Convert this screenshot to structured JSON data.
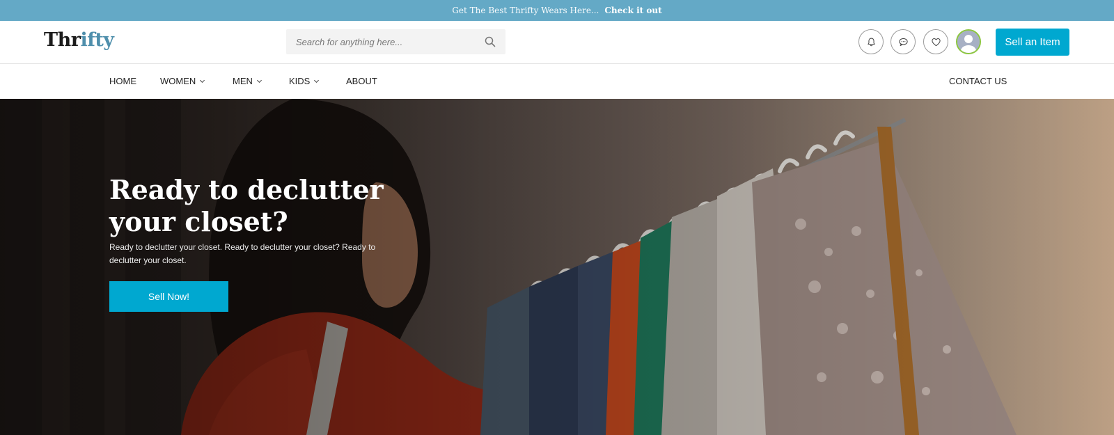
{
  "announcement": {
    "lead": "Get The Best Thrifty Wears Here...",
    "cta": "Check it out"
  },
  "header": {
    "logo_part1": "Thr",
    "logo_part2": "ifty",
    "search_placeholder": "Search for anything here...",
    "sell_label": "Sell an Item",
    "icons": [
      "bell-icon",
      "chat-icon",
      "heart-icon",
      "user-avatar"
    ]
  },
  "nav": {
    "items": [
      {
        "label": "HOME",
        "dropdown": false
      },
      {
        "label": "WOMEN",
        "dropdown": true
      },
      {
        "label": "MEN",
        "dropdown": true
      },
      {
        "label": "KIDS",
        "dropdown": true
      },
      {
        "label": "ABOUT",
        "dropdown": false
      }
    ],
    "contact": "CONTACT US"
  },
  "hero": {
    "title": "Ready to declutter your closet?",
    "subtitle": "Ready to declutter your closet. Ready to declutter your closet? Ready to declutter your closet.",
    "button": "Sell Now!"
  },
  "colors": {
    "announce_bg": "#64a9c6",
    "accent": "#00a8d0",
    "logo_accent": "#4f8fac",
    "avatar_ring": "#8cc63f"
  }
}
